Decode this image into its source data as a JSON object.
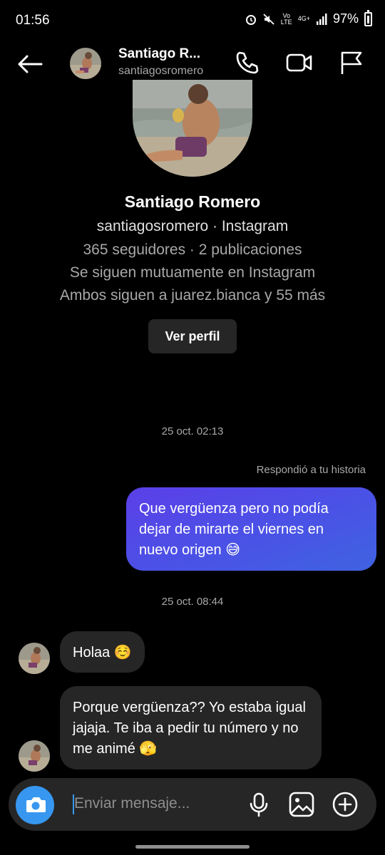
{
  "status_bar": {
    "time": "01:56",
    "network": "4G+",
    "volte": "Vo LTE",
    "battery": "97%"
  },
  "header": {
    "name": "Santiago R...",
    "username": "santiagosromero",
    "icons": [
      "back-arrow-icon",
      "phone-icon",
      "video-icon",
      "flag-icon"
    ]
  },
  "profile": {
    "name": "Santiago Romero",
    "account_line": "santiagosromero · Instagram",
    "stats_line": "365 seguidores · 2 publicaciones",
    "mutual_line": "Se siguen mutuamente en Instagram",
    "common_line": "Ambos siguen a juarez.bianca y 55 más",
    "view_button": "Ver perfil"
  },
  "messages": {
    "timestamp_1": "25 oct. 02:13",
    "reply_note": "Respondió a tu historia",
    "sent_1": "Que vergüenza pero no podía dejar de mirarte el viernes en nuevo origen 😅",
    "timestamp_2": "25 oct. 08:44",
    "received_1": "Holaa ☺️",
    "received_2": "Porque vergüenza?? Yo estaba igual jajaja. Te iba a pedir tu número y  no me animé 🫣"
  },
  "composer": {
    "placeholder": "Enviar mensaje...",
    "icons": [
      "camera-icon",
      "microphone-icon",
      "gallery-icon",
      "add-icon"
    ]
  },
  "colors": {
    "background": "#000000",
    "sent_bubble": "#4a52e6",
    "received_bubble": "#262626",
    "accent": "#3797f0",
    "secondary_text": "#a8a8a8"
  }
}
